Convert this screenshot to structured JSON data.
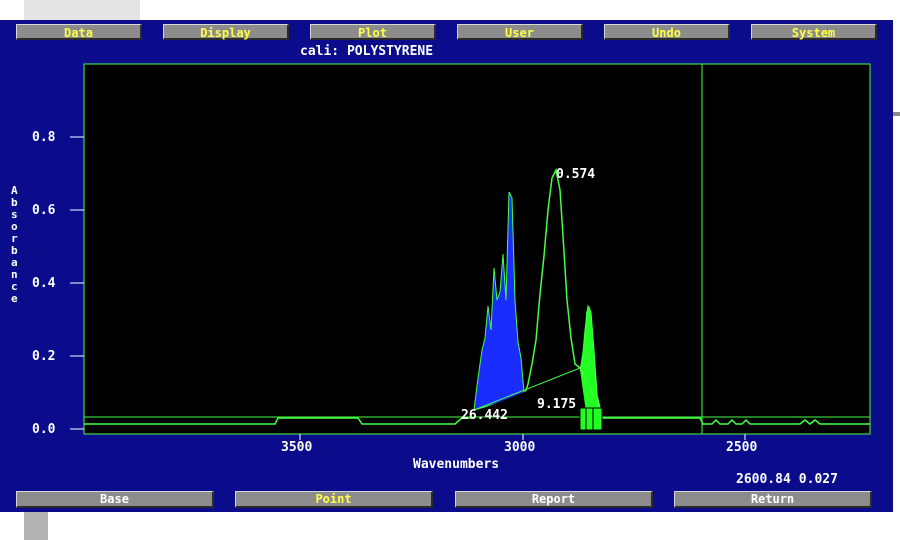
{
  "menu": {
    "items": [
      {
        "label": "Data"
      },
      {
        "label": "Display"
      },
      {
        "label": "Plot"
      },
      {
        "label": "User"
      },
      {
        "label": "Undo"
      },
      {
        "label": "System"
      }
    ]
  },
  "plot_title": "cali: POLYSTYRENE",
  "axes": {
    "y_label": "Absorbance",
    "x_label": "Wavenumbers",
    "y_ticks": [
      "0.0",
      "0.2",
      "0.4",
      "0.6",
      "0.8"
    ],
    "x_ticks": [
      "3500",
      "3000",
      "2500"
    ]
  },
  "annotations": {
    "peak_height": "0.574",
    "area_1": "26.442",
    "area_2": "9.175"
  },
  "cursor_readout": {
    "x": "2600.84",
    "y": "0.027"
  },
  "bottom_menu": {
    "items": [
      {
        "label": "Base"
      },
      {
        "label": "Point",
        "active": true
      },
      {
        "label": "Report"
      },
      {
        "label": "Return"
      }
    ]
  },
  "colors": {
    "background": "#0a0c8c",
    "plot_bg": "#000000",
    "spectrum": "#44ff44",
    "filled_area_1": "#1a2cff",
    "filled_area_2": "#22ff22",
    "menu_text": "#ffff44"
  }
}
